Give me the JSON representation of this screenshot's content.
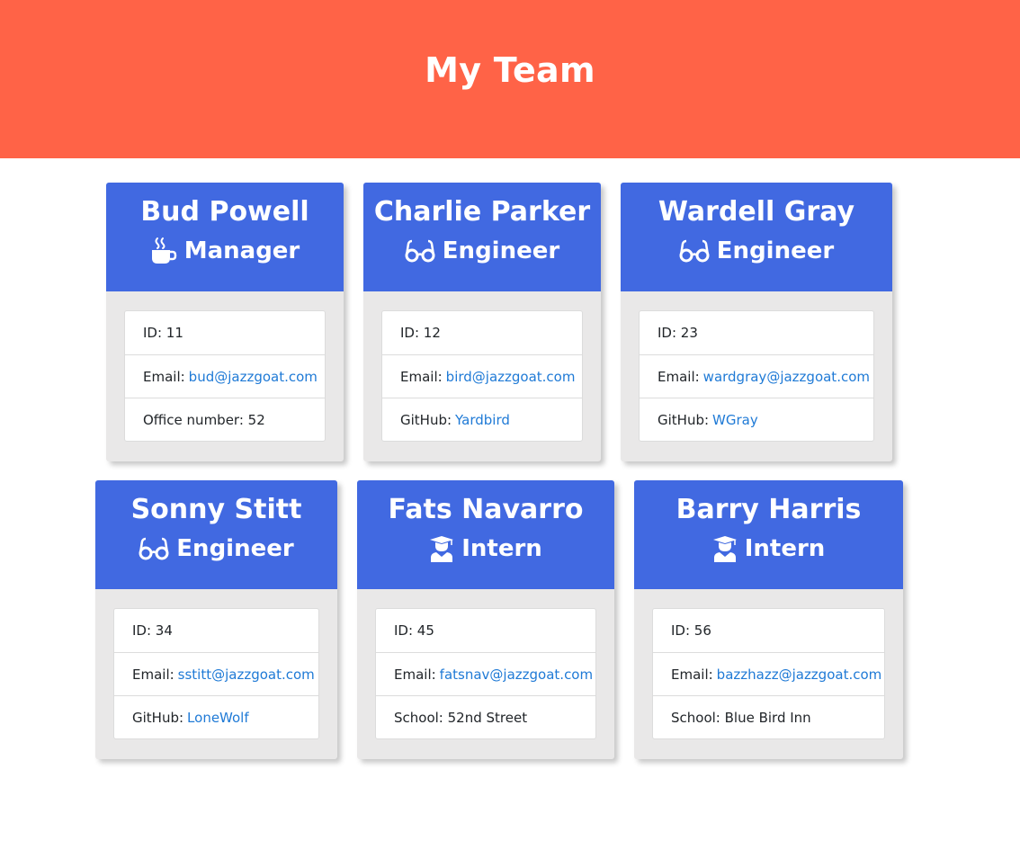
{
  "page": {
    "title": "My Team"
  },
  "colors": {
    "header_bg": "#ff6347",
    "card_header_bg": "#4169e1",
    "card_bg": "#e9e8e8",
    "link": "#1f7ad6"
  },
  "team": [
    {
      "name": "Bud Powell",
      "role": "Manager",
      "icon": "coffee-icon",
      "id_label": "ID: 11",
      "email_label": "Email:",
      "email": "bud@jazzgoat.com",
      "extra_label": "Office number: 52",
      "extra_link": ""
    },
    {
      "name": "Charlie Parker",
      "role": "Engineer",
      "icon": "glasses-icon",
      "id_label": "ID: 12",
      "email_label": "Email:",
      "email": "bird@jazzgoat.com",
      "extra_label": "GitHub:",
      "extra_link": "Yardbird"
    },
    {
      "name": "Wardell Gray",
      "role": "Engineer",
      "icon": "glasses-icon",
      "id_label": "ID: 23",
      "email_label": "Email:",
      "email": "wardgray@jazzgoat.com",
      "extra_label": "GitHub:",
      "extra_link": "WGray"
    },
    {
      "name": "Sonny Stitt",
      "role": "Engineer",
      "icon": "glasses-icon",
      "id_label": "ID: 34",
      "email_label": "Email:",
      "email": "sstitt@jazzgoat.com",
      "extra_label": "GitHub:",
      "extra_link": "LoneWolf"
    },
    {
      "name": "Fats Navarro",
      "role": "Intern",
      "icon": "graduate-icon",
      "id_label": "ID: 45",
      "email_label": "Email:",
      "email": "fatsnav@jazzgoat.com",
      "extra_label": "School: 52nd Street",
      "extra_link": ""
    },
    {
      "name": "Barry Harris",
      "role": "Intern",
      "icon": "graduate-icon",
      "id_label": "ID: 56",
      "email_label": "Email:",
      "email": "bazzhazz@jazzgoat.com",
      "extra_label": "School: Blue Bird Inn",
      "extra_link": ""
    }
  ]
}
